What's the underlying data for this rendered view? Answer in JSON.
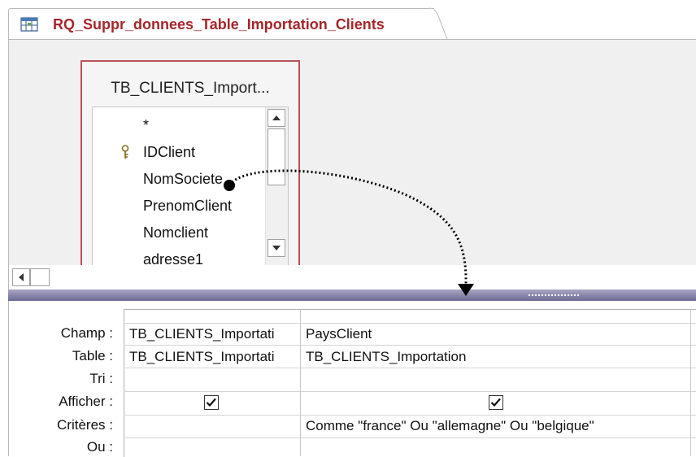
{
  "tab": {
    "title": "RQ_Suppr_donnees_Table_Importation_Clients",
    "icon": "query-icon"
  },
  "table": {
    "title": "TB_CLIENTS_Import...",
    "fields": [
      "*",
      "IDClient",
      "NomSociete",
      "PrenomClient",
      "Nomclient",
      "adresse1"
    ],
    "key_field": "IDClient"
  },
  "grid": {
    "row_labels": [
      "Champ :",
      "Table :",
      "Tri :",
      "Afficher :",
      "Critères :",
      "Ou :"
    ],
    "columns": [
      {
        "champ": "TB_CLIENTS_Importati",
        "table": "TB_CLIENTS_Importati",
        "tri": "",
        "afficher": true,
        "criteres": "",
        "ou": ""
      },
      {
        "champ": "PaysClient",
        "table": "TB_CLIENTS_Importation",
        "tri": "",
        "afficher": true,
        "criteres": "Comme \"france\" Ou \"allemagne\" Ou \"belgique\"",
        "ou": ""
      }
    ]
  },
  "colors": {
    "tab_title": "#a4262c",
    "table_border": "#b9525a",
    "splitter": "#6d6a95"
  }
}
